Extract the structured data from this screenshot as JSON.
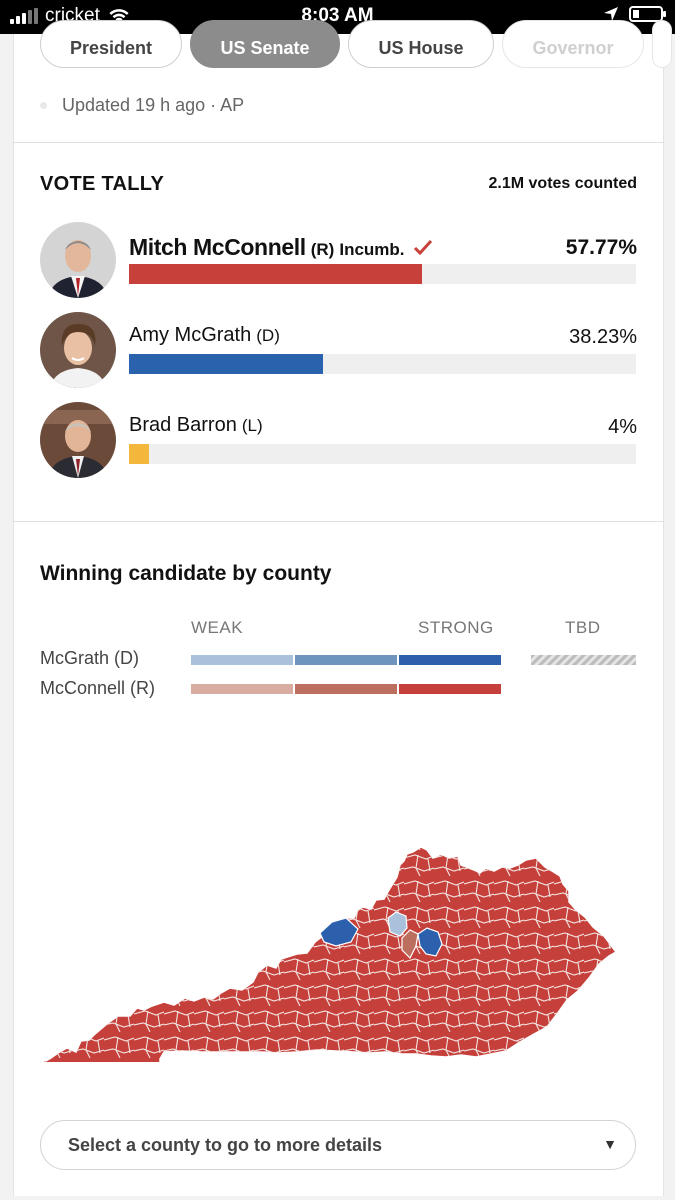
{
  "status_bar": {
    "carrier": "cricket",
    "time": "8:03 AM"
  },
  "tabs": [
    {
      "label": "President"
    },
    {
      "label": "US Senate"
    },
    {
      "label": "US House"
    },
    {
      "label": "Governor"
    }
  ],
  "updated": "Updated 19 h ago · AP",
  "tally": {
    "title": "VOTE TALLY",
    "count": "2.1M votes counted",
    "candidates": [
      {
        "name": "Mitch McConnell",
        "party": "(R)",
        "tag": "Incumb.",
        "pct": "57.77%",
        "share": 0.5777,
        "color": "#c8403a"
      },
      {
        "name": "Amy McGrath",
        "party": "(D)",
        "pct": "38.23%",
        "share": 0.3823,
        "color": "#2a62ae"
      },
      {
        "name": "Brad Barron",
        "party": "(L)",
        "pct": "4%",
        "share": 0.04,
        "color": "#f2b73b"
      }
    ]
  },
  "county_map": {
    "title": "Winning candidate by county",
    "legend": {
      "weak": "WEAK",
      "strong": "STRONG",
      "tbd": "TBD",
      "dem_label": "McGrath  (D)",
      "rep_label": "McConnell  (R)",
      "dem_colors": [
        "#a9c1da",
        "#6f94be",
        "#2c60ad"
      ],
      "rep_colors": [
        "#d9aca2",
        "#bd6f5f",
        "#c5403a"
      ]
    }
  },
  "select": {
    "placeholder": "Select a county to go to more details"
  }
}
